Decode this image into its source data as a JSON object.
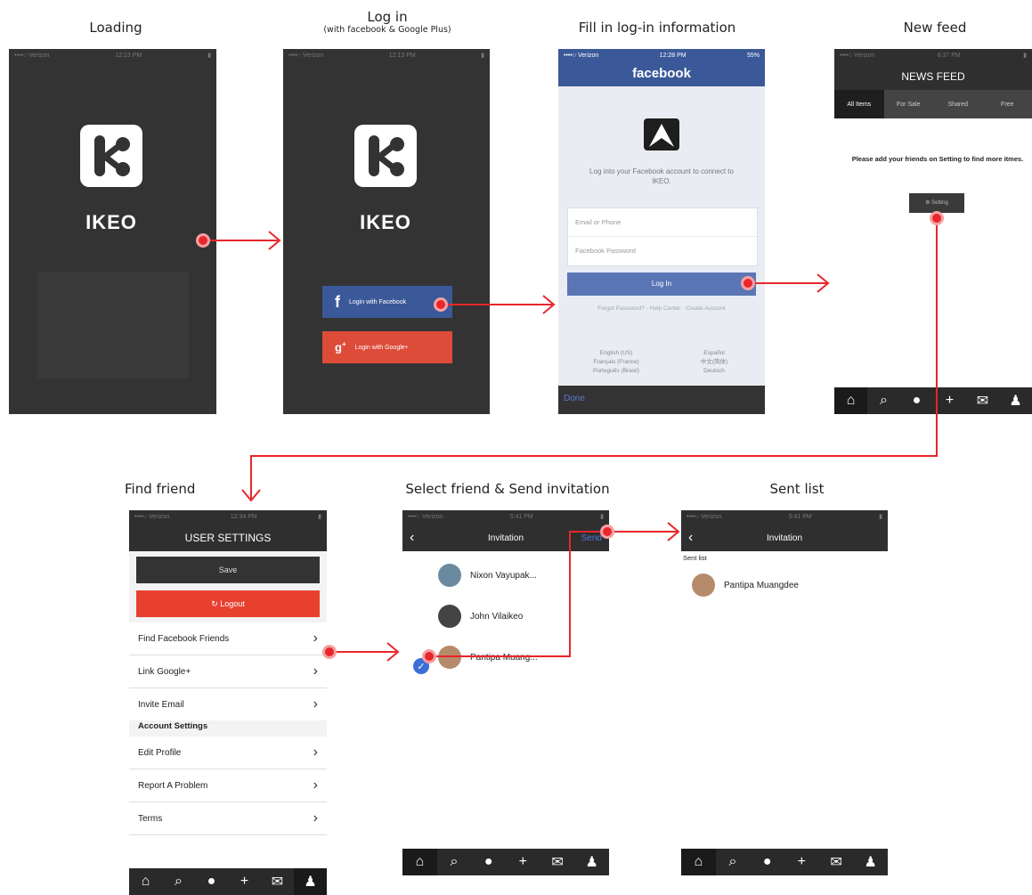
{
  "captions": {
    "loading": "Loading",
    "login": "Log in",
    "login_sub": "(with facebook & Google Plus)",
    "fill": "Fill in log-in information",
    "newfeed": "New feed",
    "find": "Find friend",
    "select": "Select friend & Send invitation",
    "sent": "Sent list"
  },
  "app": {
    "name": "IKEO"
  },
  "status": {
    "carrier": "••••○ Verizon",
    "time_loading": "12:13 PM",
    "time_fb": "12:28 PM",
    "battery_fb": "55%",
    "time_feed": "6:37 PM",
    "time_settings": "12:34 PM",
    "time_invite": "5:41 PM"
  },
  "login": {
    "facebook_btn": "Login with Facebook",
    "google_btn": "Login with Google+"
  },
  "facebook": {
    "brand": "facebook",
    "prompt": "Log into your Facebook account to connect to IKEO.",
    "email_placeholder": "Email or Phone",
    "password_placeholder": "Facebook Password",
    "login_btn": "Log In",
    "links": "Forgot Password? · Help Center · Create Account",
    "langs_left": [
      "English (US)",
      "Français (France)",
      "Português (Brasil)"
    ],
    "langs_right": [
      "Español",
      "中文(简体)",
      "Deutsch"
    ],
    "done": "Done"
  },
  "feed": {
    "title": "NEWS FEED",
    "tabs": [
      "All Items",
      "For Sale",
      "Shared",
      "Free"
    ],
    "message": "Please add your friends on Setting to find more itmes.",
    "setting_btn": "⚙ Setting"
  },
  "settings": {
    "title": "USER SETTINGS",
    "save": "Save",
    "logout": "Logout",
    "rows_top": [
      "Find Facebook Friends",
      "Link Google+",
      "Invite Email"
    ],
    "section": "Account Settings",
    "rows_bottom": [
      "Edit Profile",
      "Report A Problem",
      "Terms"
    ]
  },
  "invitation": {
    "title": "Invitation",
    "send": "Send",
    "friends": [
      "Nixon Vayupak...",
      "John Vilaikeo",
      "Pantipa Muang..."
    ]
  },
  "sentlist": {
    "title": "Invitation",
    "label": "Sent list",
    "friends": [
      "Pantipa Muangdee"
    ]
  },
  "tabbar_icons": [
    "home-icon",
    "search-icon",
    "chat-icon",
    "plus-icon",
    "mail-icon",
    "user-icon"
  ],
  "colors": {
    "arrow": "#e8262b",
    "facebook": "#3b5998",
    "google": "#dd4b39",
    "dark": "#333333"
  }
}
